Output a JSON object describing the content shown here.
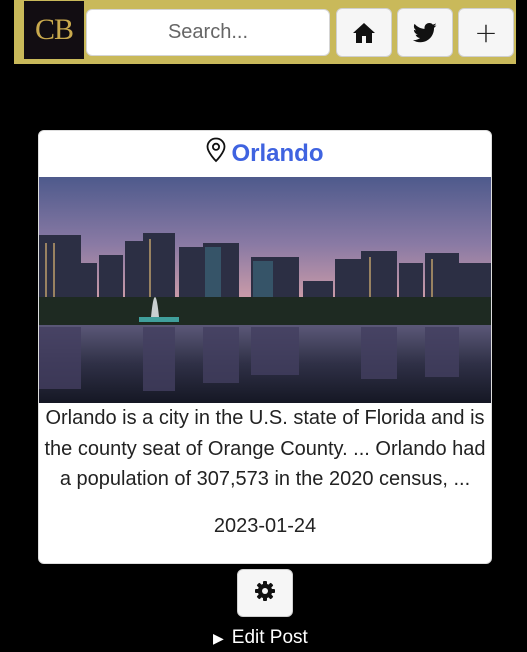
{
  "header": {
    "logo_text": "CB",
    "search_placeholder": "Search...",
    "buttons": [
      {
        "icon": "home-icon"
      },
      {
        "icon": "twitter-icon"
      },
      {
        "icon": "plus-icon",
        "label": "+"
      }
    ]
  },
  "post": {
    "location_icon": "map-pin-icon",
    "title": "Orlando",
    "image_alt": "Orlando skyline at dusk over Lake Eola with fountain",
    "description": "Orlando is a city in the U.S. state of Florida and is the county seat of Orange County. ... Orlando had a population of 307,573 in the 2020 census, ...",
    "date": "2023-01-24"
  },
  "actions": {
    "settings_icon": "gear-icon",
    "edit_marker": "▶",
    "edit_label": "Edit Post"
  },
  "colors": {
    "header_bar": "#c9b95a",
    "logo_bg": "#120d12",
    "logo_text": "#c9a94d",
    "link": "#3f63e0",
    "page_bg": "#000000"
  }
}
